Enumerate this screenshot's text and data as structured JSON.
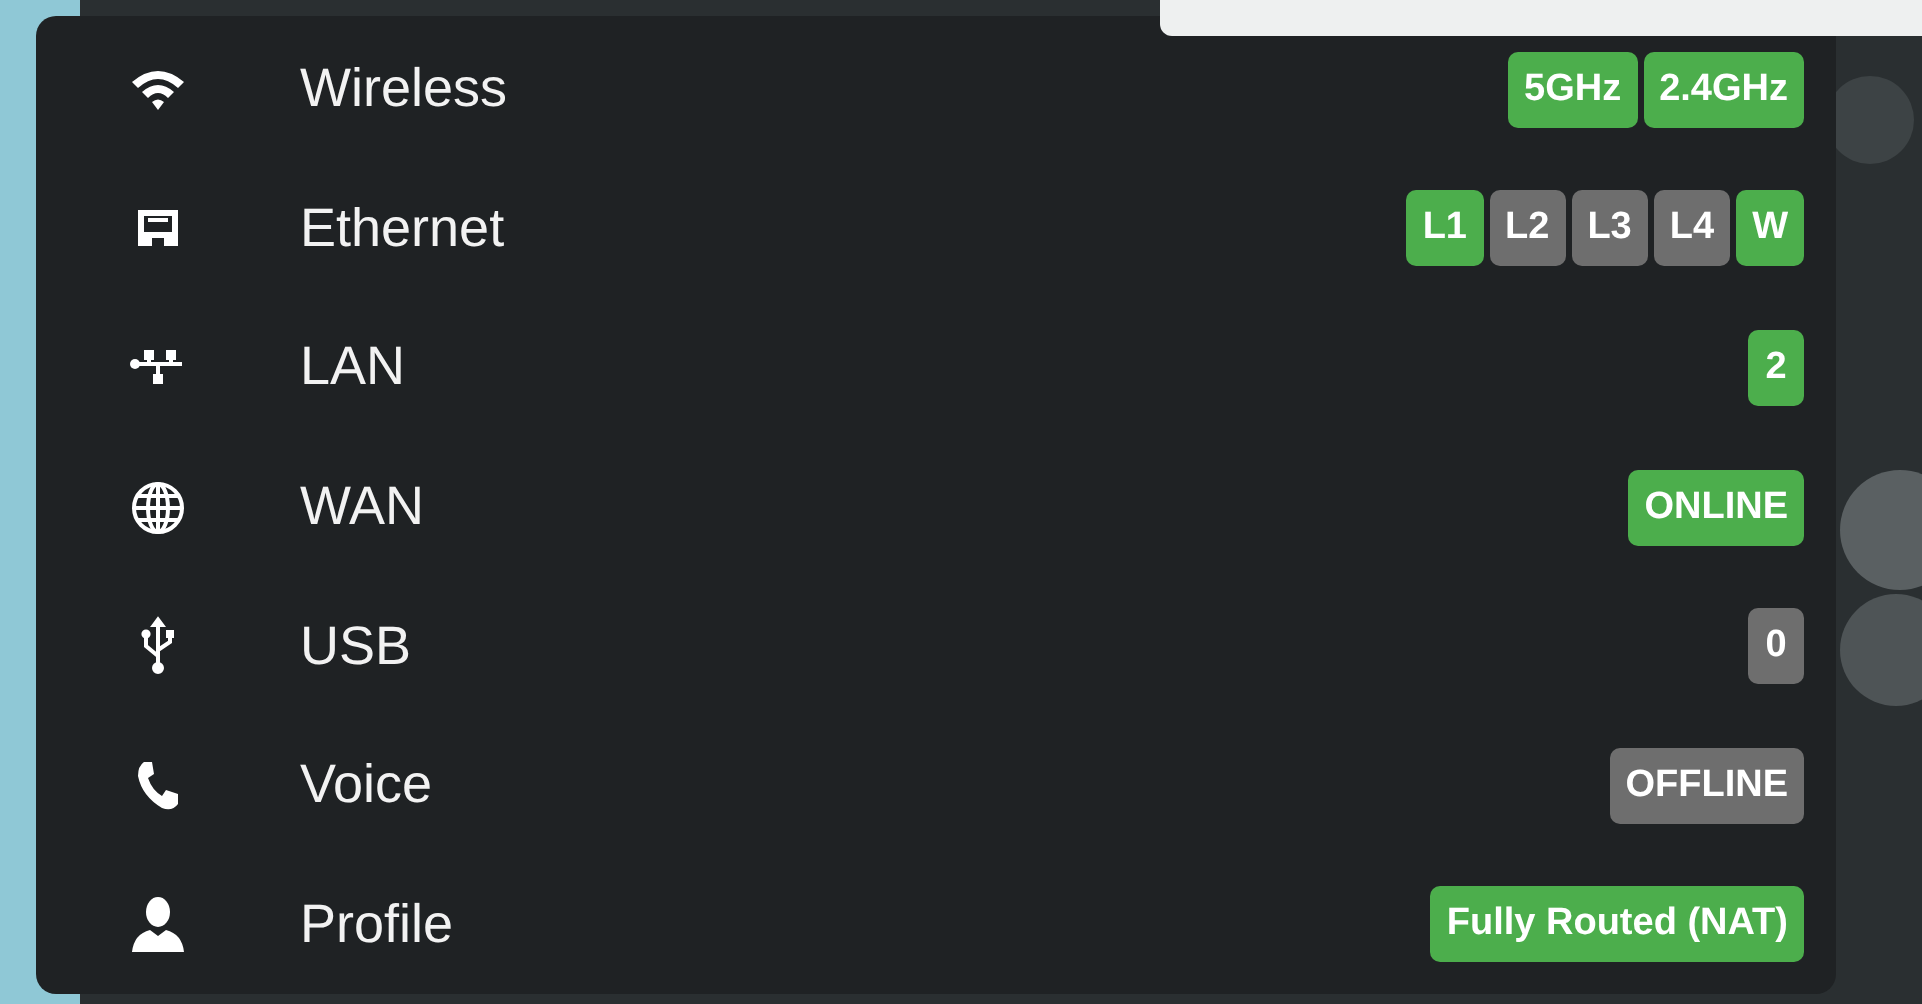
{
  "rows": [
    {
      "kind": "wireless",
      "label": "Wireless",
      "badges": [
        {
          "text": "5GHz",
          "on": true
        },
        {
          "text": "2.4GHz",
          "on": true
        }
      ]
    },
    {
      "kind": "ethernet",
      "label": "Ethernet",
      "badges": [
        {
          "text": "L1",
          "on": true
        },
        {
          "text": "L2",
          "on": false
        },
        {
          "text": "L3",
          "on": false
        },
        {
          "text": "L4",
          "on": false
        },
        {
          "text": "W",
          "on": true
        }
      ]
    },
    {
      "kind": "lan",
      "label": "LAN",
      "badges": [
        {
          "text": "2",
          "on": true
        }
      ]
    },
    {
      "kind": "wan",
      "label": "WAN",
      "badges": [
        {
          "text": "ONLINE",
          "on": true
        }
      ]
    },
    {
      "kind": "usb",
      "label": "USB",
      "badges": [
        {
          "text": "0",
          "on": false
        }
      ]
    },
    {
      "kind": "voice",
      "label": "Voice",
      "badges": [
        {
          "text": "OFFLINE",
          "on": false
        }
      ]
    },
    {
      "kind": "profile",
      "label": "Profile",
      "badges": [
        {
          "text": "Fully Routed (NAT)",
          "on": true
        }
      ]
    }
  ]
}
